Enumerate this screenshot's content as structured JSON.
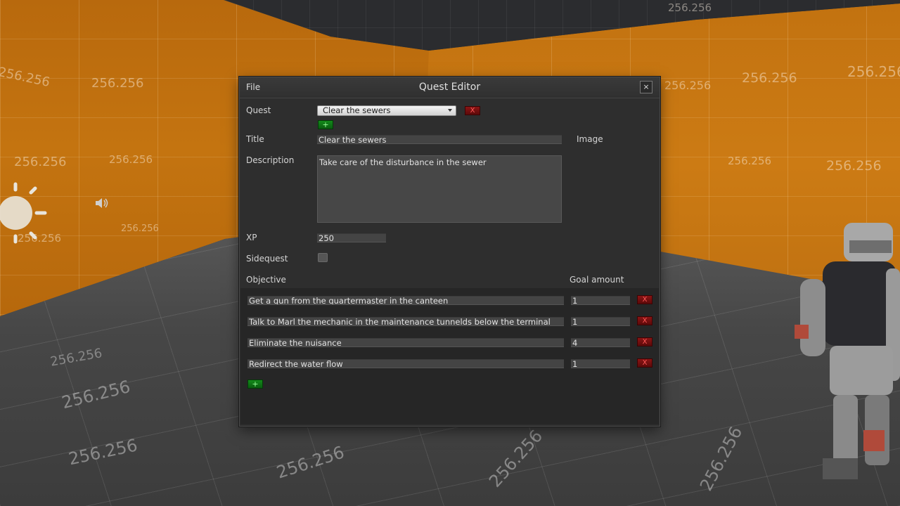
{
  "scene": {
    "wall_labels": [
      "256.256",
      "256.256",
      "256.256",
      "256.256",
      "256.256",
      "256.256",
      "256.256",
      "256.256",
      "256.256",
      "256.256",
      "256.256",
      "256.256"
    ],
    "floor_labels": [
      "256.256",
      "256.256",
      "256.256",
      "256.256",
      "256.256",
      "256.256"
    ]
  },
  "window": {
    "menu_file": "File",
    "title": "Quest Editor",
    "close_label": "×"
  },
  "form": {
    "quest_label": "Quest",
    "quest_selected": "Clear the sewers",
    "delete_label": "X",
    "add_label": "+",
    "title_label": "Title",
    "title_value": "Clear the sewers",
    "image_label": "Image",
    "description_label": "Description",
    "description_value": "Take care of the disturbance in the sewer",
    "xp_label": "XP",
    "xp_value": "250",
    "sidequest_label": "Sidequest",
    "sidequest_checked": false,
    "objective_header": "Objective",
    "goal_header": "Goal amount"
  },
  "objectives": [
    {
      "text": "Get a gun from the quartermaster in the canteen",
      "goal": "1"
    },
    {
      "text": "Talk to Marl the mechanic in the maintenance tunnelds below the terminal",
      "goal": "1"
    },
    {
      "text": "Eliminate the nuisance",
      "goal": "4"
    },
    {
      "text": "Redirect the water flow",
      "goal": "1"
    }
  ],
  "colors": {
    "wall": "#c47410",
    "window_bg": "#2e2e2e",
    "delete_button": "#8a1515",
    "add_button": "#138a1a"
  }
}
